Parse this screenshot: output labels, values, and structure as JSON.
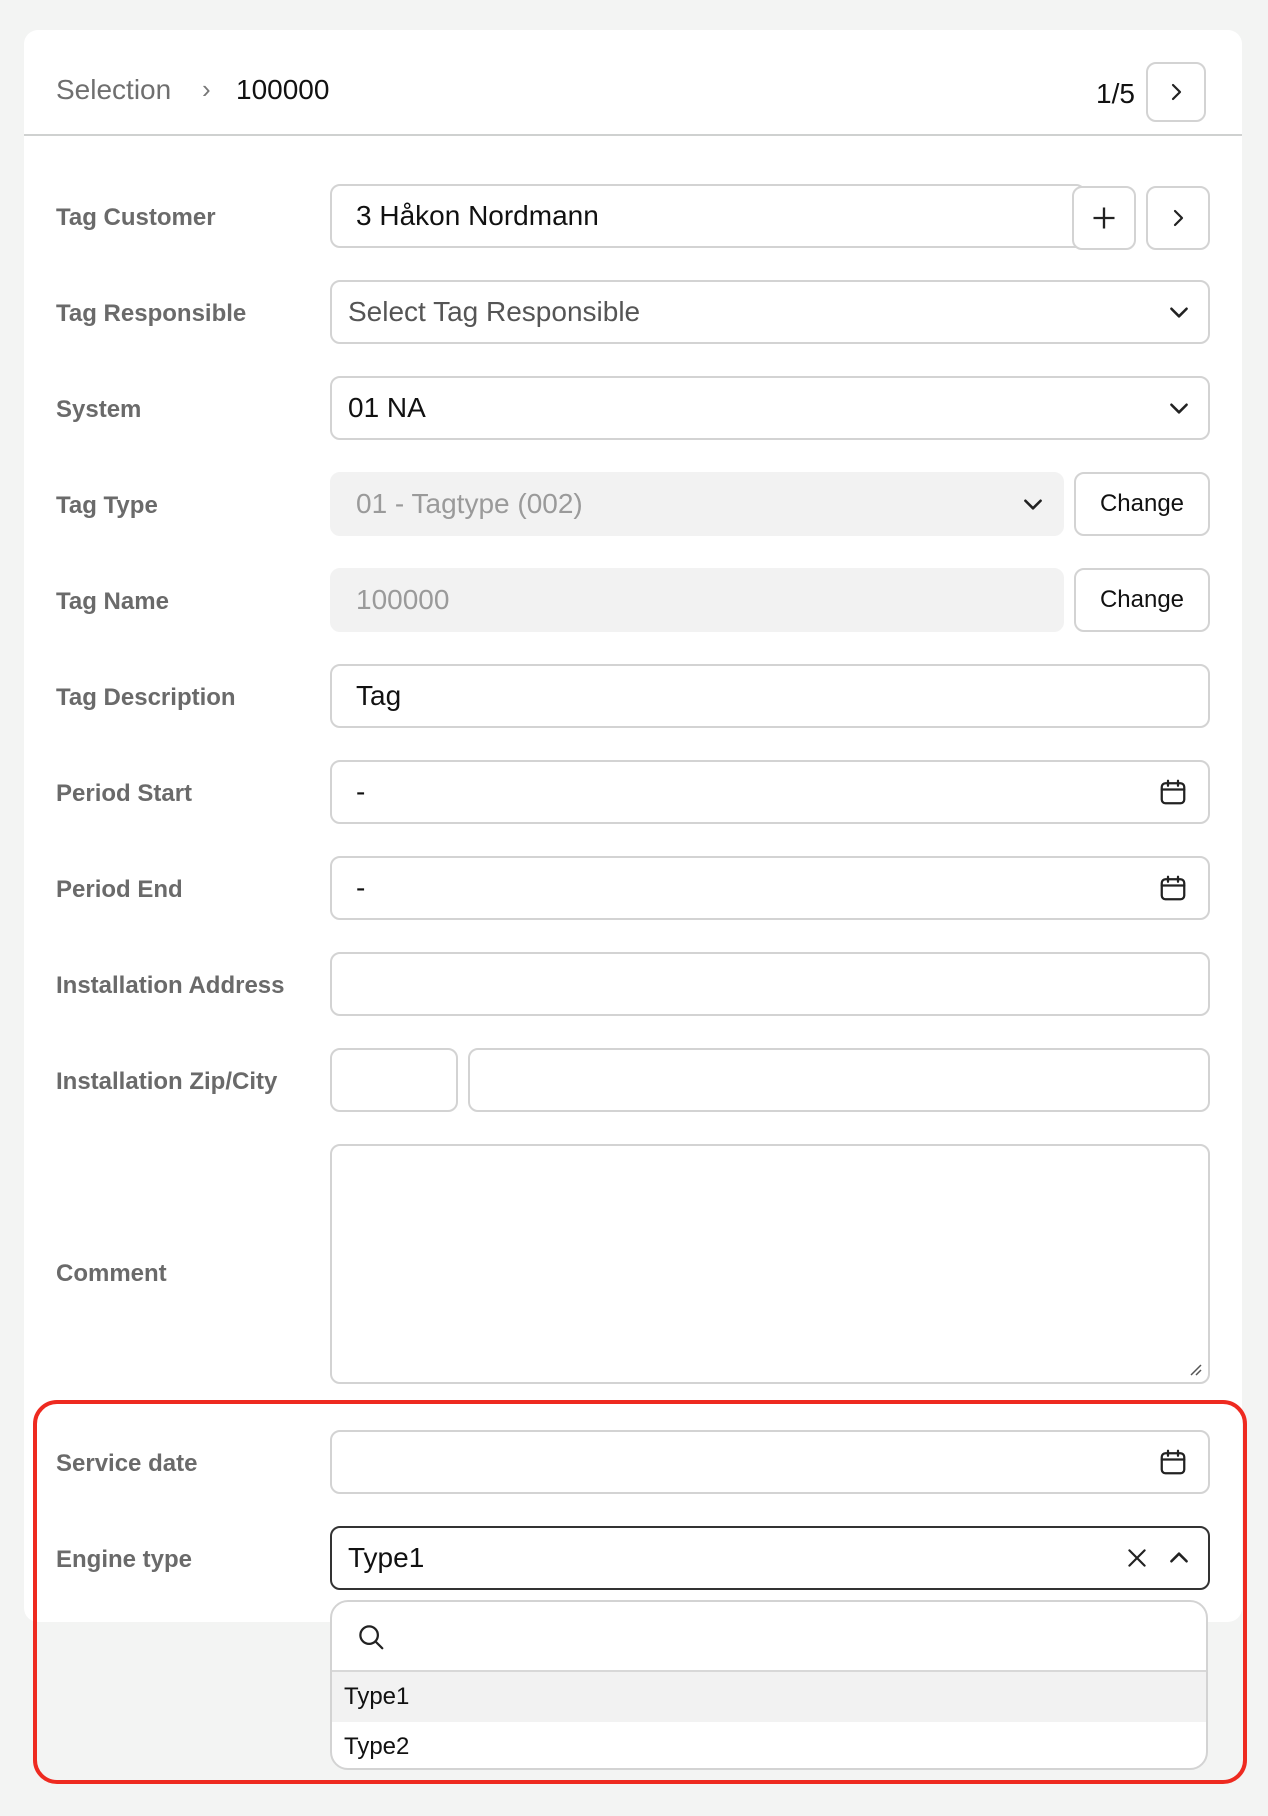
{
  "breadcrumb": {
    "root": "Selection",
    "separator": "›",
    "current": "100000"
  },
  "pager": {
    "text": "1/5"
  },
  "form": {
    "tag_customer": {
      "label": "Tag Customer",
      "value": "3 Håkon Nordmann"
    },
    "tag_responsible": {
      "label": "Tag Responsible",
      "placeholder": "Select Tag Responsible"
    },
    "system": {
      "label": "System",
      "value": "01 NA"
    },
    "tag_type": {
      "label": "Tag Type",
      "value": "01 - Tagtype (002)",
      "change_label": "Change"
    },
    "tag_name": {
      "label": "Tag Name",
      "value": "100000",
      "change_label": "Change"
    },
    "tag_description": {
      "label": "Tag Description",
      "value": "Tag"
    },
    "period_start": {
      "label": "Period Start",
      "value": "-"
    },
    "period_end": {
      "label": "Period End",
      "value": "-"
    },
    "installation_address": {
      "label": "Installation Address",
      "value": ""
    },
    "installation_zip_city": {
      "label": "Installation Zip/City",
      "zip": "",
      "city": ""
    },
    "comment": {
      "label": "Comment",
      "value": ""
    },
    "service_date": {
      "label": "Service date",
      "value": ""
    },
    "engine_type": {
      "label": "Engine type",
      "value": "Type1"
    }
  },
  "engine_dropdown": {
    "search_placeholder": "",
    "options": [
      "Type1",
      "Type2"
    ]
  },
  "colors": {
    "highlight": "#ee2a20",
    "page_bg": "#f3f4f3",
    "disabled_bg": "#f2f2f2",
    "border": "#d3d3d3"
  },
  "icons": [
    "chevron-right-icon",
    "plus-icon",
    "chevron-down-icon",
    "chevron-up-icon",
    "calendar-icon",
    "close-icon",
    "search-icon",
    "resize-grabber-icon"
  ]
}
